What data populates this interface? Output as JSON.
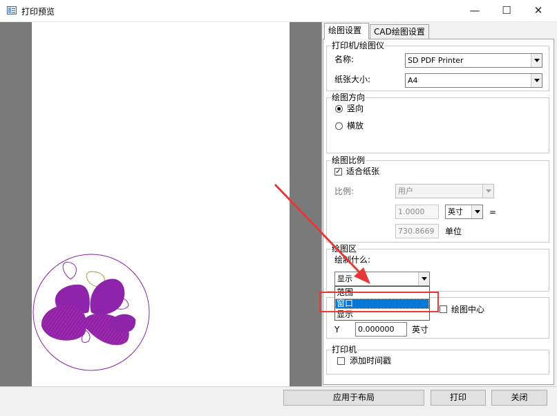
{
  "window": {
    "title": "打印预览",
    "controls": {
      "minimize": "—",
      "maximize": "☐",
      "close": "✕"
    }
  },
  "tabs": [
    {
      "label": "绘图设置",
      "active": true
    },
    {
      "label": "CAD绘图设置",
      "active": false
    }
  ],
  "printer_group": {
    "title": "打印机/绘图仪",
    "name_label": "名称:",
    "name_value": "SD PDF Printer",
    "paper_label": "纸张大小:",
    "paper_value": "A4"
  },
  "orientation_group": {
    "title": "绘图方向",
    "options": [
      {
        "label": "竖向",
        "checked": true
      },
      {
        "label": "横放",
        "checked": false
      }
    ]
  },
  "scale_group": {
    "title": "绘图比例",
    "fit_label": "适合纸张",
    "fit_checked": true,
    "ratio_label": "比例:",
    "ratio_value": "用户",
    "scale_value": "1.0000",
    "unit_value": "英寸",
    "equals": "=",
    "units_value": "730.8669",
    "units_label": "单位"
  },
  "area_group": {
    "title": "绘图区",
    "what_label": "绘制什么:",
    "selected": "显示",
    "options": [
      {
        "label": "范围",
        "selected": false
      },
      {
        "label": "窗口",
        "selected": true
      },
      {
        "label": "显示",
        "selected": false
      }
    ]
  },
  "offset_group": {
    "center_label": "绘图中心",
    "center_checked": false,
    "y_label": "Y",
    "y_value": "0.000000",
    "y_unit": "英寸"
  },
  "printer_opts_group": {
    "title": "打印机",
    "timestamp_label": "添加时间戳",
    "timestamp_checked": false
  },
  "buttons": {
    "apply": "应用于布局",
    "print": "打印",
    "close": "关闭"
  },
  "colors": {
    "annotation": "#e53935",
    "selection": "#0078d7",
    "drawing": "#8e24aa"
  }
}
